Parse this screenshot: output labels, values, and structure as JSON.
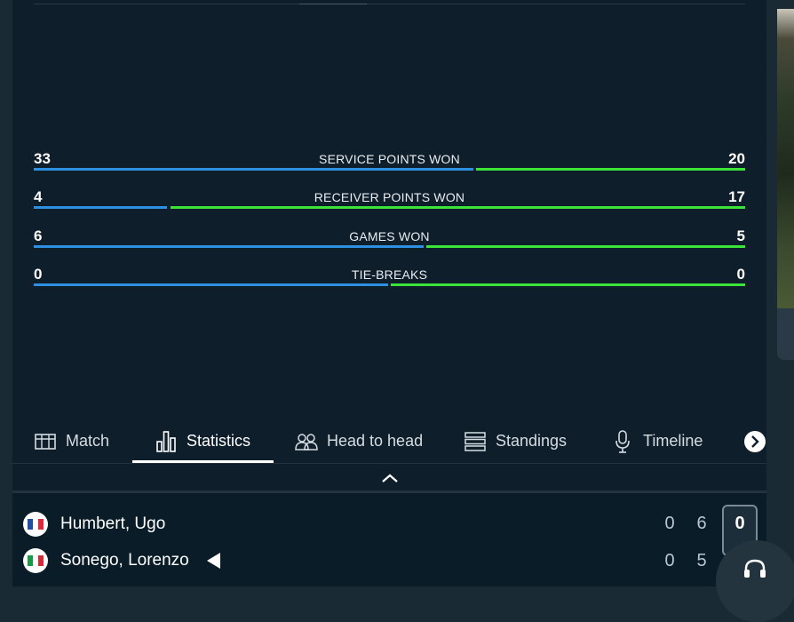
{
  "stats": [
    {
      "label": "SERVICE POINTS WON",
      "left": "33",
      "right": "20",
      "left_share": 0.62
    },
    {
      "label": "RECEIVER POINTS WON",
      "left": "4",
      "right": "17",
      "left_share": 0.19
    },
    {
      "label": "GAMES WON",
      "left": "6",
      "right": "5",
      "left_share": 0.55
    },
    {
      "label": "TIE-BREAKS",
      "left": "0",
      "right": "0",
      "left_share": 0.5
    }
  ],
  "tabs": [
    {
      "label": "Match",
      "icon": "table-icon"
    },
    {
      "label": "Statistics",
      "icon": "bar-chart-icon",
      "active": true
    },
    {
      "label": "Head to head",
      "icon": "people-icon"
    },
    {
      "label": "Standings",
      "icon": "list-icon"
    },
    {
      "label": "Timeline",
      "icon": "microphone-icon"
    }
  ],
  "scoreboard": {
    "players": [
      {
        "name": "Humbert, Ugo",
        "flag": "france-flag-icon",
        "sets": [
          "0",
          "6"
        ],
        "current": "0",
        "serving": false
      },
      {
        "name": "Sonego, Lorenzo",
        "flag": "italy-flag-icon",
        "sets": [
          "0",
          "5"
        ],
        "current": "0",
        "serving": true
      }
    ]
  },
  "colors": {
    "player1_bar": "#2f8fe0",
    "player2_bar": "#3ce43a",
    "background": "#0f1e2b"
  }
}
